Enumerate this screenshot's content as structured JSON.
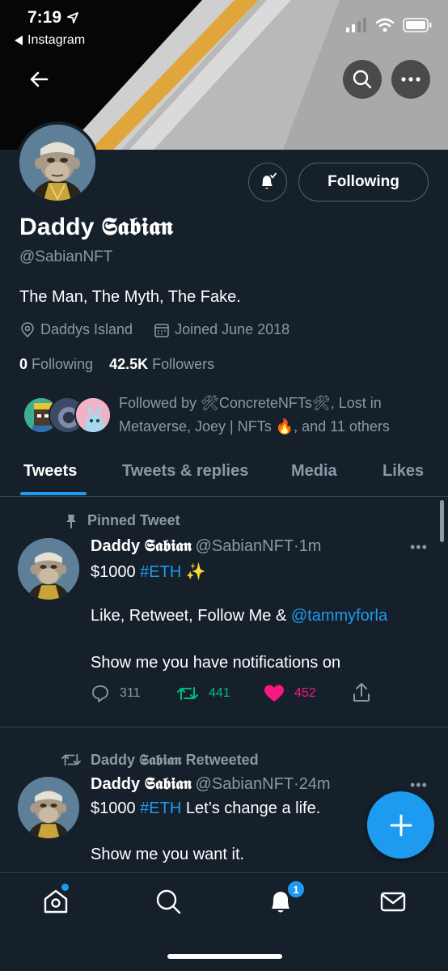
{
  "status_bar": {
    "time": "7:19",
    "back_app": "Instagram"
  },
  "profile": {
    "display_name": "Daddy 𝕾𝖆𝖇𝖎𝖆𝖓",
    "handle": "@SabianNFT",
    "bio": "The Man, The Myth, The Fake.",
    "location": "Daddys Island",
    "joined": "Joined June 2018",
    "following_count": "0",
    "following_label": "Following",
    "followers_count": "42.5K",
    "followers_label": "Followers",
    "follow_button_label": "Following",
    "followed_by_text": "Followed by 🛠ConcreteNFTs🛠, Lost in Metaverse, Joey | NFTs 🔥, and 11 others"
  },
  "tabs": [
    {
      "label": "Tweets",
      "active": true
    },
    {
      "label": "Tweets & replies",
      "active": false
    },
    {
      "label": "Media",
      "active": false
    },
    {
      "label": "Likes",
      "active": false
    }
  ],
  "tweets": [
    {
      "context": "Pinned Tweet",
      "name": "Daddy 𝕾𝖆𝖇𝖎𝖆𝖓",
      "handle": "@SabianNFT",
      "time": "1m",
      "line1_text": "$1000 ",
      "line1_hashtag": "#ETH",
      "line1_emoji": " ✨",
      "line2_text": "Like, Retweet, Follow Me & ",
      "line2_mention": "@tammyforla",
      "line3_text": "Show me you have notifications on",
      "replies": "311",
      "retweets": "441",
      "likes": "452"
    },
    {
      "context": "Daddy 𝕾𝖆𝖇𝖎𝖆𝖓 Retweeted",
      "name": "Daddy 𝕾𝖆𝖇𝖎𝖆𝖓",
      "handle": "@SabianNFT",
      "time": "24m",
      "line1_text": "$1000 ",
      "line1_hashtag": "#ETH",
      "line1_rest": " Let’s change a life.",
      "line2_text": "Show me you want it."
    }
  ],
  "notifications_badge": "1",
  "colors": {
    "background": "#15202b",
    "accent": "#1d9bf0",
    "secondary_text": "#8b98a5",
    "retweet_green": "#00ba7c",
    "like_pink": "#f91880"
  },
  "icons": [
    "back-arrow-icon",
    "search-icon",
    "more-icon",
    "bell-icon",
    "location-icon",
    "calendar-icon",
    "pin-icon",
    "reply-icon",
    "retweet-icon",
    "heart-icon",
    "share-icon",
    "compose-plus-icon",
    "home-icon",
    "notifications-icon",
    "messages-icon"
  ]
}
